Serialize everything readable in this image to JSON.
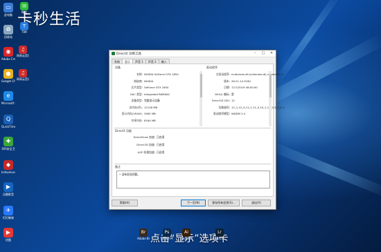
{
  "watermark": "卡秒生活",
  "desktop_icons": [
    {
      "label": "此电脑",
      "icon": "computer-icon",
      "color": "#3a7bd5"
    },
    {
      "label": "回收站",
      "icon": "recycle-bin-icon",
      "color": "#8aa6c1"
    },
    {
      "label": "Adobe Creati...",
      "icon": "adobe-cc-icon",
      "color": "#d9252a"
    },
    {
      "label": "Google Chrome",
      "icon": "chrome-icon",
      "color": "#e8b21f"
    },
    {
      "label": "Microsoft Edge",
      "icon": "edge-icon",
      "color": "#1e88e5"
    },
    {
      "label": "QuickTime Player",
      "icon": "quicktime-icon",
      "color": "#1a5fb4"
    },
    {
      "label": "360安全卫士",
      "icon": "security-360-icon",
      "color": "#3aa63a"
    },
    {
      "label": "Icdsumunc",
      "icon": "app-icon",
      "color": "#c62828"
    },
    {
      "label": "迅雷影音",
      "icon": "player-icon",
      "color": "#1565c0"
    },
    {
      "label": "钉钉教育",
      "icon": "dingtalk-icon",
      "color": "#2979ff"
    },
    {
      "label": "优酷",
      "icon": "youku-icon",
      "color": "#e53935"
    }
  ],
  "desktop_icons_col2": [
    {
      "label": "微信",
      "icon": "wechat-icon",
      "color": "#2fbf3a"
    },
    {
      "label": "TIM",
      "icon": "tim-icon",
      "color": "#2a7de1"
    },
    {
      "label": "网易云音乐",
      "icon": "netease-music-icon",
      "color": "#d12a2a"
    },
    {
      "label": "网易云音乐",
      "icon": "netease-music-icon",
      "color": "#d12a2a"
    }
  ],
  "window": {
    "title": "DirectX 诊断工具",
    "tabs": [
      "系统",
      "显示",
      "声音 1",
      "声音 2",
      "输入"
    ],
    "active_tab": 1,
    "device_group": "设备",
    "driver_group": "驱动程序",
    "device": [
      {
        "k": "名称:",
        "v": "NVIDIA GeForce GTX 1650"
      },
      {
        "k": "制造商:",
        "v": "NVIDIA"
      },
      {
        "k": "芯片类型:",
        "v": "GeForce GTX 1650"
      },
      {
        "k": "DAC 类型:",
        "v": "Integrated RAMDAC"
      },
      {
        "k": "设备类型:",
        "v": "完整显示设备"
      },
      {
        "k": "总内存(约):",
        "v": "12126 MB"
      },
      {
        "k": "显示内存(VRAM):",
        "v": "3962 MB"
      },
      {
        "k": "共享内存:",
        "v": "8164 MB"
      }
    ],
    "driver": [
      {
        "k": "主驱动程序:",
        "v": "nvldumdx.dll,nvldumdx.dll,nvldumdx.d"
      },
      {
        "k": "版本:",
        "v": "26.21.14.3160"
      },
      {
        "k": "日期:",
        "v": "7/17/2019 08:00:00"
      },
      {
        "k": "WHQL 徽标:",
        "v": "是"
      },
      {
        "k": "Direct3D DDI:",
        "v": "12"
      },
      {
        "k": "功能级别:",
        "v": "12_1,12_0,11_1,11_0,10_1,10_0,9_3,9_2"
      },
      {
        "k": "驱动程序模型:",
        "v": "WDDM 2.4"
      }
    ],
    "directx_group": "DirectX 功能",
    "features": [
      {
        "k": "DirectDraw 加速:",
        "v": "已启用"
      },
      {
        "k": "Direct3D 加速:",
        "v": "已启用"
      },
      {
        "k": "AGP 纹理加速:",
        "v": "已启用"
      }
    ],
    "notes_group": "备注",
    "notes_text": "• 没有发现问题。",
    "buttons": {
      "help": "帮助(H)",
      "next": "下一页(N)",
      "save": "保存所有信息(S)...",
      "exit": "退出(X)"
    }
  },
  "caption": "点击“显示”选项卡",
  "taskbar_icons": [
    {
      "label": "Adobe Bridge ...",
      "icon": "bridge-icon",
      "color": "#3b2a1a"
    },
    {
      "label": "Adobe Photosh...",
      "icon": "photoshop-icon",
      "color": "#0b2a4a"
    },
    {
      "label": "Adobe Illustrat...",
      "icon": "illustrator-icon",
      "color": "#3a1e05"
    },
    {
      "label": "Lightro...",
      "icon": "lightroom-icon",
      "color": "#0d2033"
    }
  ]
}
